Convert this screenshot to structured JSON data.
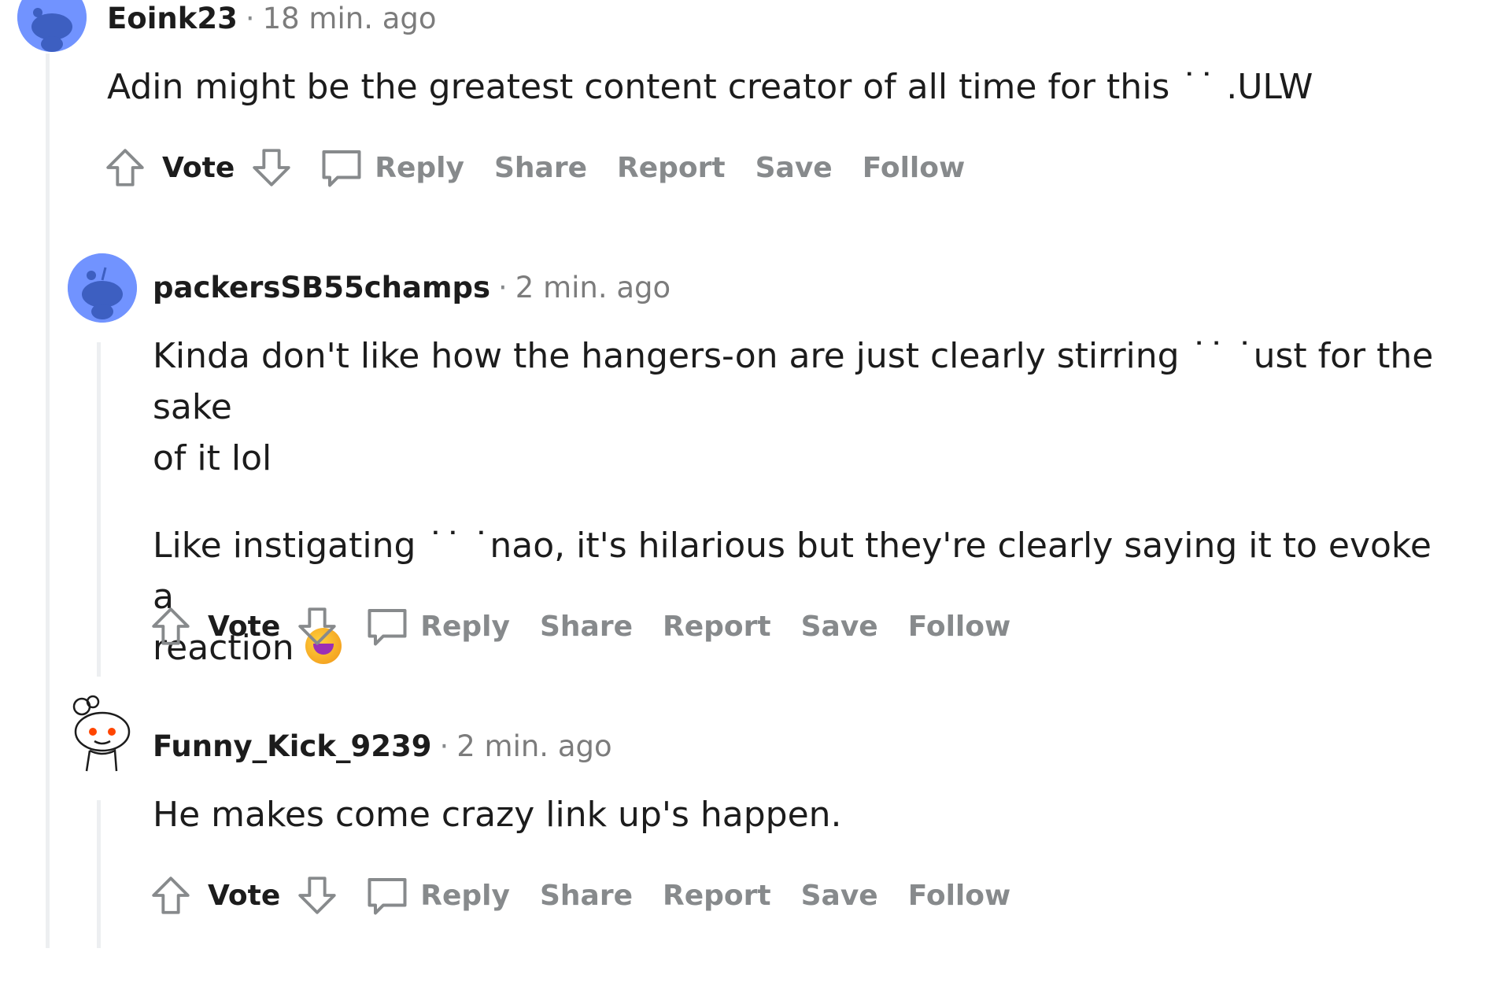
{
  "comments": [
    {
      "username": "Eoink23",
      "separator": "·",
      "time": "18 min. ago",
      "lines": [
        "Adin might be the greatest content creator of all time for this ˙˙ .ULW"
      ],
      "actions": {
        "vote": "Vote",
        "reply": "Reply",
        "share": "Share",
        "report": "Report",
        "save": "Save",
        "follow": "Follow"
      }
    },
    {
      "username": "packersSB55champs",
      "separator": "·",
      "time": "2 min. ago",
      "paragraphs": [
        [
          "Kinda don't like how the hangers-on are just clearly stirring ˙˙ ˙ust for the sake",
          "of it lol"
        ],
        [
          "Like instigating ˙˙ ˙nao, it's hilarious but they're clearly saying it to evoke a",
          "reaction"
        ]
      ],
      "actions": {
        "vote": "Vote",
        "reply": "Reply",
        "share": "Share",
        "report": "Report",
        "save": "Save",
        "follow": "Follow"
      }
    },
    {
      "username": "Funny_Kick_9239",
      "separator": "·",
      "time": "2 min. ago",
      "lines": [
        "He makes come crazy link up's happen."
      ],
      "actions": {
        "vote": "Vote",
        "reply": "Reply",
        "share": "Share",
        "report": "Report",
        "save": "Save",
        "follow": "Follow"
      }
    }
  ],
  "colors": {
    "avatar_blue": "#7193ff",
    "snoo_orange": "#ff4500",
    "thread_line": "#edeff1",
    "meta_gray": "#7c7c7c",
    "action_gray": "#878a8c"
  },
  "icons": [
    "snoo-avatar-icon",
    "upvote-icon",
    "downvote-icon",
    "comment-icon",
    "laughing-emoji-icon"
  ]
}
